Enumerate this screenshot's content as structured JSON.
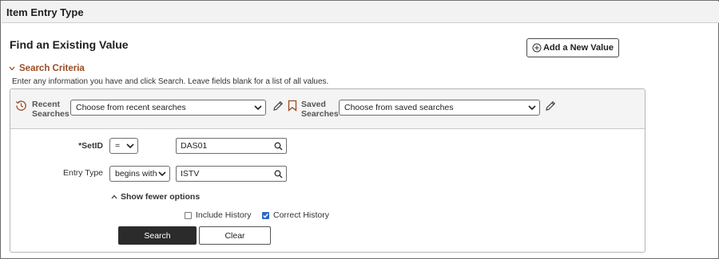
{
  "page": {
    "title": "Item Entry Type",
    "heading": "Find an Existing Value",
    "add_new_label": "Add a New Value"
  },
  "criteria": {
    "toggle_label": "Search Criteria",
    "instructions": "Enter any information you have and click Search. Leave fields blank for a list of all values."
  },
  "recent": {
    "label_line1": "Recent",
    "label_line2": "Searches",
    "dropdown_value": "Choose from recent searches"
  },
  "saved": {
    "label_line1": "Saved",
    "label_line2": "Searches",
    "dropdown_value": "Choose from saved searches"
  },
  "fields": {
    "setid": {
      "label": "*SetID",
      "operator": "=",
      "value": "DAS01"
    },
    "entry_type": {
      "label": "Entry Type",
      "operator": "begins with",
      "value": "ISTV"
    }
  },
  "options": {
    "show_fewer_label": "Show fewer options",
    "include_history": {
      "label": "Include History",
      "checked": false
    },
    "correct_history": {
      "label": "Correct History",
      "checked": true
    }
  },
  "buttons": {
    "search": "Search",
    "clear": "Clear"
  },
  "icons": {
    "add": "plus-circle-icon",
    "expand": "chevron-down-icon",
    "recent": "history-icon",
    "saved": "bookmark-icon",
    "edit": "pencil-icon",
    "lookup": "magnifier-icon",
    "collapse": "chevron-up-icon",
    "checked": "checkmark-icon"
  },
  "colors": {
    "accent": "#9c4b24",
    "checkbox": "#2c6cc4",
    "primary_button": "#2b2b2b"
  }
}
